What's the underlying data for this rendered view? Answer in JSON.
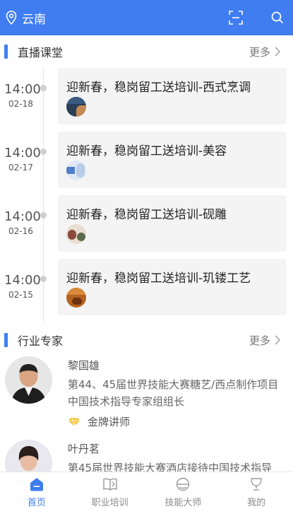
{
  "header": {
    "location": "云南",
    "icons": {
      "location": "location-pin-icon",
      "scan": "scan-icon",
      "search": "search-icon"
    }
  },
  "live": {
    "title": "直播课堂",
    "more": "更多",
    "items": [
      {
        "time": "14:00",
        "date": "02-18",
        "title": "迎新春，稳岗留工送培训-西式烹调"
      },
      {
        "time": "14:00",
        "date": "02-17",
        "title": "迎新春，稳岗留工送培训-美容"
      },
      {
        "time": "14:00",
        "date": "02-16",
        "title": "迎新春，稳岗留工送培训-砚雕"
      },
      {
        "time": "14:00",
        "date": "02-15",
        "title": "迎新春，稳岗留工送培训-玑镂工艺"
      }
    ]
  },
  "experts": {
    "title": "行业专家",
    "more": "更多",
    "items": [
      {
        "name": "黎国雄",
        "desc": "第44、45届世界技能大赛糖艺/西点制作项目中国技术指导专家组组长",
        "badge": "金牌讲师"
      },
      {
        "name": "叶丹茗",
        "desc": "第45届世界技能大赛酒店接待中国技术指导"
      }
    ]
  },
  "tabbar": {
    "tabs": [
      {
        "label": "首页",
        "active": true
      },
      {
        "label": "职业培训",
        "active": false
      },
      {
        "label": "技能大师",
        "active": false
      },
      {
        "label": "我的",
        "active": false
      }
    ]
  },
  "colors": {
    "accent": "#3f7df1",
    "badge": "#f2c230"
  }
}
